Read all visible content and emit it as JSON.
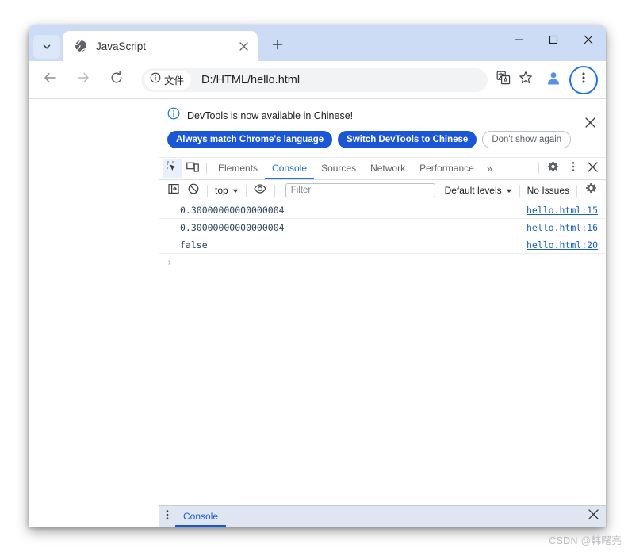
{
  "window": {
    "tab_search_icon": "chevron-down-icon",
    "tabs": [
      {
        "favicon": "globe-icon",
        "title": "JavaScript",
        "close_icon": "close-icon"
      }
    ],
    "new_tab_icon": "plus-icon",
    "controls": {
      "minimize_icon": "minimize-icon",
      "maximize_icon": "maximize-icon",
      "close_icon": "close-icon"
    }
  },
  "toolbar": {
    "back_icon": "arrow-left-icon",
    "forward_icon": "arrow-right-icon",
    "reload_icon": "reload-icon",
    "site_chip": {
      "icon": "info-circle-icon",
      "label": "文件"
    },
    "url": "D:/HTML/hello.html",
    "translate_icon": "translate-icon",
    "bookmark_icon": "star-icon",
    "profile_icon": "avatar-icon",
    "menu_icon": "three-dots-vertical-icon"
  },
  "devtools": {
    "notice": {
      "icon": "info-circle-icon",
      "text": "DevTools is now available in Chinese!",
      "buttons": [
        {
          "label": "Always match Chrome's language",
          "style": "primary"
        },
        {
          "label": "Switch DevTools to Chinese",
          "style": "primary"
        },
        {
          "label": "Don't show again",
          "style": "outline"
        }
      ],
      "close_icon": "close-icon"
    },
    "tabbar": {
      "inspect_icon": "inspect-cursor-icon",
      "device_icon": "device-toolbar-icon",
      "tabs": [
        {
          "label": "Elements",
          "selected": false
        },
        {
          "label": "Console",
          "selected": true
        },
        {
          "label": "Sources",
          "selected": false
        },
        {
          "label": "Network",
          "selected": false
        },
        {
          "label": "Performance",
          "selected": false
        }
      ],
      "overflow_label": "»",
      "settings_icon": "gear-icon",
      "more_icon": "three-dots-vertical-icon",
      "close_icon": "close-icon"
    },
    "console_toolbar": {
      "sidebar_icon": "show-console-sidebar-icon",
      "clear_icon": "clear-console-icon",
      "context_label": "top",
      "context_caret": "▼",
      "live_expression_icon": "eye-icon",
      "filter_placeholder": "Filter",
      "filter_value": "",
      "levels_label": "Default levels",
      "levels_caret": "▼",
      "issues_label": "No Issues",
      "settings_icon": "gear-icon"
    },
    "console_messages": [
      {
        "value": "0.30000000000000004",
        "source": "hello.html:15"
      },
      {
        "value": "0.30000000000000004",
        "source": "hello.html:16"
      },
      {
        "value": "false",
        "source": "hello.html:20"
      }
    ],
    "prompt_caret": "›",
    "drawer": {
      "more_icon": "three-dots-vertical-icon",
      "tab_label": "Console",
      "close_icon": "close-icon"
    }
  },
  "watermark": "CSDN @韩曙亮",
  "colors": {
    "accent_blue": "#1a73e8",
    "button_blue": "#1a56d6",
    "tabstrip_blue": "#ccdcf5",
    "drawer_blue": "#dfe6f2",
    "console_text": "#30455c",
    "link_blue": "#1a5fd0"
  }
}
